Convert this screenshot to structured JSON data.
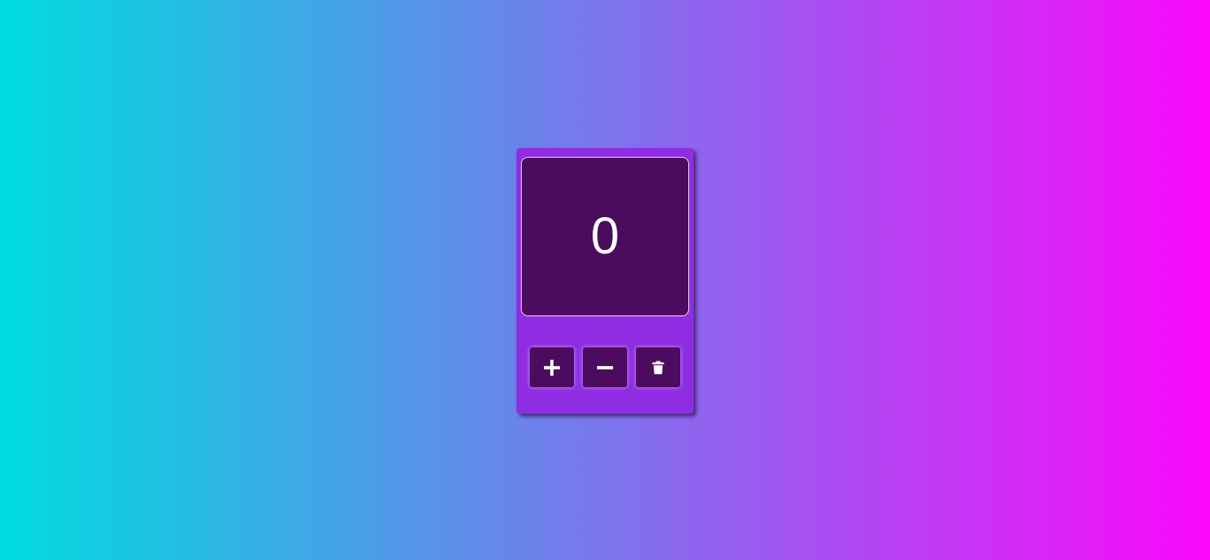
{
  "counter": {
    "value": "0"
  },
  "buttons": {
    "increment_icon": "plus-icon",
    "decrement_icon": "minus-icon",
    "reset_icon": "trash-icon"
  },
  "colors": {
    "background_start": "#00dcdf",
    "background_end": "#fb08fb",
    "card": "#8e2de2",
    "display": "#4b0b5e",
    "text": "#ffffff"
  }
}
